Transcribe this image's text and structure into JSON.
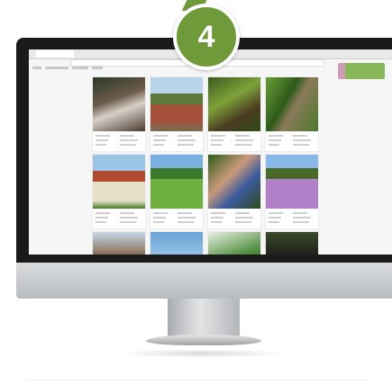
{
  "step_badge": {
    "number": "4",
    "color": "#6f9a3a"
  },
  "screen": {
    "cards": [
      {
        "image": "castle-model-photo"
      },
      {
        "image": "town-aerial-photo"
      },
      {
        "image": "forest-person-photo"
      },
      {
        "image": "forest-trees-photo"
      },
      {
        "image": "half-timbered-house-photo"
      },
      {
        "image": "green-meadow-photo"
      },
      {
        "image": "man-with-magnifier-photo"
      },
      {
        "image": "flower-field-photo"
      },
      {
        "image": "tower-figures-photo"
      },
      {
        "image": "sky-photo"
      },
      {
        "image": "palm-leaves-photo"
      },
      {
        "image": "display-device-photo"
      }
    ]
  }
}
